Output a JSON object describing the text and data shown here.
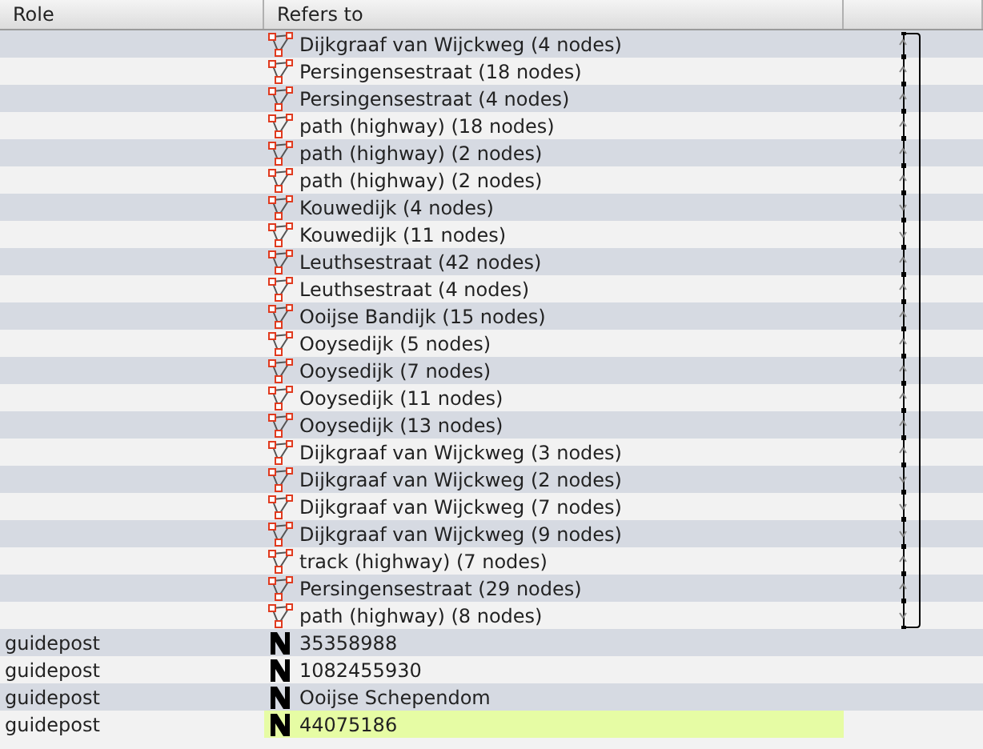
{
  "columns": [
    "Role",
    "Refers to"
  ],
  "rows": [
    {
      "role": "",
      "kind": "way",
      "name": "Dijkgraaf van Wijckweg (4 nodes)",
      "arrow_up": true,
      "highlighted": false
    },
    {
      "role": "",
      "kind": "way",
      "name": "Persingensestraat (18 nodes)",
      "arrow_up": true,
      "highlighted": false
    },
    {
      "role": "",
      "kind": "way",
      "name": "Persingensestraat (4 nodes)",
      "arrow_up": true,
      "highlighted": false
    },
    {
      "role": "",
      "kind": "way",
      "name": "path (highway) (18 nodes)",
      "arrow_up": true,
      "highlighted": false
    },
    {
      "role": "",
      "kind": "way",
      "name": "path (highway) (2 nodes)",
      "arrow_up": true,
      "highlighted": false
    },
    {
      "role": "",
      "kind": "way",
      "name": "path (highway) (2 nodes)",
      "arrow_up": true,
      "highlighted": false
    },
    {
      "role": "",
      "kind": "way",
      "name": "Kouwedijk (4 nodes)",
      "arrow_up": false,
      "highlighted": false
    },
    {
      "role": "",
      "kind": "way",
      "name": "Kouwedijk (11 nodes)",
      "arrow_up": false,
      "highlighted": false
    },
    {
      "role": "",
      "kind": "way",
      "name": "Leuthsestraat (42 nodes)",
      "arrow_up": true,
      "highlighted": false
    },
    {
      "role": "",
      "kind": "way",
      "name": "Leuthsestraat (4 nodes)",
      "arrow_up": true,
      "highlighted": false
    },
    {
      "role": "",
      "kind": "way",
      "name": "Ooijse Bandijk (15 nodes)",
      "arrow_up": true,
      "highlighted": false
    },
    {
      "role": "",
      "kind": "way",
      "name": "Ooysedijk (5 nodes)",
      "arrow_up": true,
      "highlighted": false
    },
    {
      "role": "",
      "kind": "way",
      "name": "Ooysedijk (7 nodes)",
      "arrow_up": true,
      "highlighted": false
    },
    {
      "role": "",
      "kind": "way",
      "name": "Ooysedijk (11 nodes)",
      "arrow_up": true,
      "highlighted": false
    },
    {
      "role": "",
      "kind": "way",
      "name": "Ooysedijk (13 nodes)",
      "arrow_up": true,
      "highlighted": false
    },
    {
      "role": "",
      "kind": "way",
      "name": "Dijkgraaf van Wijckweg (3 nodes)",
      "arrow_up": true,
      "highlighted": false
    },
    {
      "role": "",
      "kind": "way",
      "name": "Dijkgraaf van Wijckweg (2 nodes)",
      "arrow_up": false,
      "highlighted": false
    },
    {
      "role": "",
      "kind": "way",
      "name": "Dijkgraaf van Wijckweg (7 nodes)",
      "arrow_up": false,
      "highlighted": false
    },
    {
      "role": "",
      "kind": "way",
      "name": "Dijkgraaf van Wijckweg (9 nodes)",
      "arrow_up": false,
      "highlighted": false
    },
    {
      "role": "",
      "kind": "way",
      "name": "track (highway) (7 nodes)",
      "arrow_up": true,
      "highlighted": false
    },
    {
      "role": "",
      "kind": "way",
      "name": "Persingensestraat (29 nodes)",
      "arrow_up": true,
      "highlighted": false
    },
    {
      "role": "",
      "kind": "way",
      "name": "path (highway) (8 nodes)",
      "arrow_up": false,
      "highlighted": false
    },
    {
      "role": "guidepost",
      "kind": "node",
      "name": "35358988",
      "highlighted": false
    },
    {
      "role": "guidepost",
      "kind": "node",
      "name": "1082455930",
      "highlighted": false
    },
    {
      "role": "guidepost",
      "kind": "node",
      "name": "Ooijse Schependom",
      "highlighted": false
    },
    {
      "role": "guidepost",
      "kind": "node",
      "name": "44075186",
      "highlighted": true
    }
  ]
}
